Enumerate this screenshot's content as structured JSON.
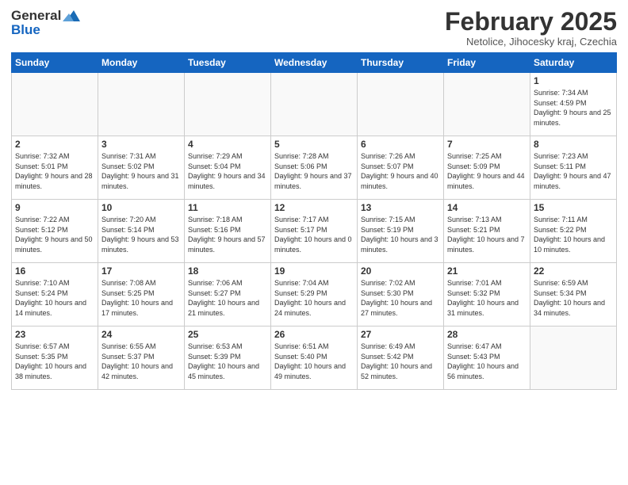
{
  "header": {
    "logo_line1": "General",
    "logo_line2": "Blue",
    "month": "February 2025",
    "location": "Netolice, Jihocesky kraj, Czechia"
  },
  "weekdays": [
    "Sunday",
    "Monday",
    "Tuesday",
    "Wednesday",
    "Thursday",
    "Friday",
    "Saturday"
  ],
  "weeks": [
    [
      {
        "day": "",
        "info": ""
      },
      {
        "day": "",
        "info": ""
      },
      {
        "day": "",
        "info": ""
      },
      {
        "day": "",
        "info": ""
      },
      {
        "day": "",
        "info": ""
      },
      {
        "day": "",
        "info": ""
      },
      {
        "day": "1",
        "info": "Sunrise: 7:34 AM\nSunset: 4:59 PM\nDaylight: 9 hours and 25 minutes."
      }
    ],
    [
      {
        "day": "2",
        "info": "Sunrise: 7:32 AM\nSunset: 5:01 PM\nDaylight: 9 hours and 28 minutes."
      },
      {
        "day": "3",
        "info": "Sunrise: 7:31 AM\nSunset: 5:02 PM\nDaylight: 9 hours and 31 minutes."
      },
      {
        "day": "4",
        "info": "Sunrise: 7:29 AM\nSunset: 5:04 PM\nDaylight: 9 hours and 34 minutes."
      },
      {
        "day": "5",
        "info": "Sunrise: 7:28 AM\nSunset: 5:06 PM\nDaylight: 9 hours and 37 minutes."
      },
      {
        "day": "6",
        "info": "Sunrise: 7:26 AM\nSunset: 5:07 PM\nDaylight: 9 hours and 40 minutes."
      },
      {
        "day": "7",
        "info": "Sunrise: 7:25 AM\nSunset: 5:09 PM\nDaylight: 9 hours and 44 minutes."
      },
      {
        "day": "8",
        "info": "Sunrise: 7:23 AM\nSunset: 5:11 PM\nDaylight: 9 hours and 47 minutes."
      }
    ],
    [
      {
        "day": "9",
        "info": "Sunrise: 7:22 AM\nSunset: 5:12 PM\nDaylight: 9 hours and 50 minutes."
      },
      {
        "day": "10",
        "info": "Sunrise: 7:20 AM\nSunset: 5:14 PM\nDaylight: 9 hours and 53 minutes."
      },
      {
        "day": "11",
        "info": "Sunrise: 7:18 AM\nSunset: 5:16 PM\nDaylight: 9 hours and 57 minutes."
      },
      {
        "day": "12",
        "info": "Sunrise: 7:17 AM\nSunset: 5:17 PM\nDaylight: 10 hours and 0 minutes."
      },
      {
        "day": "13",
        "info": "Sunrise: 7:15 AM\nSunset: 5:19 PM\nDaylight: 10 hours and 3 minutes."
      },
      {
        "day": "14",
        "info": "Sunrise: 7:13 AM\nSunset: 5:21 PM\nDaylight: 10 hours and 7 minutes."
      },
      {
        "day": "15",
        "info": "Sunrise: 7:11 AM\nSunset: 5:22 PM\nDaylight: 10 hours and 10 minutes."
      }
    ],
    [
      {
        "day": "16",
        "info": "Sunrise: 7:10 AM\nSunset: 5:24 PM\nDaylight: 10 hours and 14 minutes."
      },
      {
        "day": "17",
        "info": "Sunrise: 7:08 AM\nSunset: 5:25 PM\nDaylight: 10 hours and 17 minutes."
      },
      {
        "day": "18",
        "info": "Sunrise: 7:06 AM\nSunset: 5:27 PM\nDaylight: 10 hours and 21 minutes."
      },
      {
        "day": "19",
        "info": "Sunrise: 7:04 AM\nSunset: 5:29 PM\nDaylight: 10 hours and 24 minutes."
      },
      {
        "day": "20",
        "info": "Sunrise: 7:02 AM\nSunset: 5:30 PM\nDaylight: 10 hours and 27 minutes."
      },
      {
        "day": "21",
        "info": "Sunrise: 7:01 AM\nSunset: 5:32 PM\nDaylight: 10 hours and 31 minutes."
      },
      {
        "day": "22",
        "info": "Sunrise: 6:59 AM\nSunset: 5:34 PM\nDaylight: 10 hours and 34 minutes."
      }
    ],
    [
      {
        "day": "23",
        "info": "Sunrise: 6:57 AM\nSunset: 5:35 PM\nDaylight: 10 hours and 38 minutes."
      },
      {
        "day": "24",
        "info": "Sunrise: 6:55 AM\nSunset: 5:37 PM\nDaylight: 10 hours and 42 minutes."
      },
      {
        "day": "25",
        "info": "Sunrise: 6:53 AM\nSunset: 5:39 PM\nDaylight: 10 hours and 45 minutes."
      },
      {
        "day": "26",
        "info": "Sunrise: 6:51 AM\nSunset: 5:40 PM\nDaylight: 10 hours and 49 minutes."
      },
      {
        "day": "27",
        "info": "Sunrise: 6:49 AM\nSunset: 5:42 PM\nDaylight: 10 hours and 52 minutes."
      },
      {
        "day": "28",
        "info": "Sunrise: 6:47 AM\nSunset: 5:43 PM\nDaylight: 10 hours and 56 minutes."
      },
      {
        "day": "",
        "info": ""
      }
    ]
  ]
}
